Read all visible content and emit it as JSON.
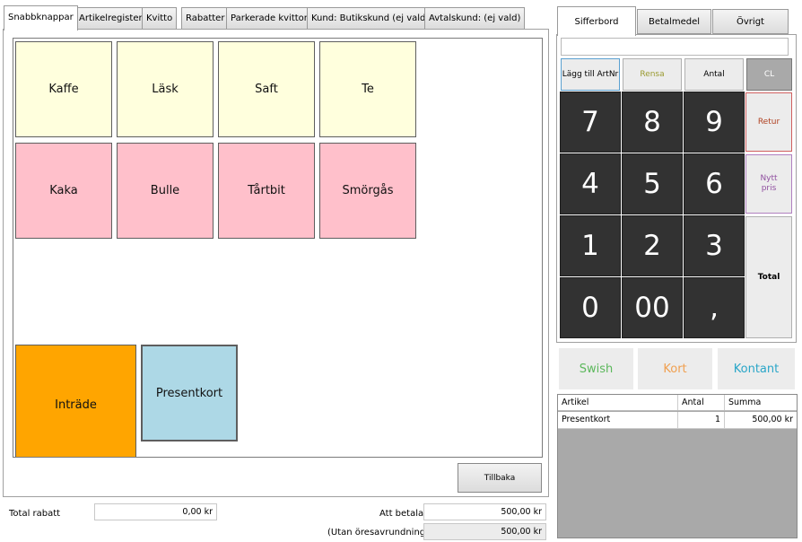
{
  "tabs": [
    "Snabbknappar",
    "Artikelregister",
    "Kvitto",
    "Rabatter",
    "Parkerade kvitton",
    "Kund: Butikskund (ej vald)",
    "Avtalskund: (ej vald)"
  ],
  "quick_buttons": [
    "Kaffe",
    "Läsk",
    "Saft",
    "Te",
    "Kaka",
    "Bulle",
    "Tårtbit",
    "Smörgås",
    "Inträde",
    "Presentkort"
  ],
  "back_label": "Tillbaka",
  "totals": {
    "discount_label": "Total rabatt",
    "discount_value": "0,00 kr",
    "to_pay_label": "Att betala",
    "to_pay_value": "500,00 kr",
    "no_rounding_label": "(Utan öresavrundning)",
    "no_rounding_value": "500,00 kr"
  },
  "right_tabs": [
    "Sifferbord",
    "Betalmedel",
    "Övrigt"
  ],
  "numpad_input": {
    "value": ""
  },
  "fn_buttons": {
    "add_artnr": "Lägg till ArtNr",
    "clear": "Rensa",
    "qty": "Antal",
    "cl": "CL"
  },
  "keys": [
    "7",
    "8",
    "9",
    "4",
    "5",
    "6",
    "1",
    "2",
    "3",
    "0",
    "00",
    ","
  ],
  "side_buttons": {
    "return": "Retur",
    "new_price": "Nytt pris",
    "total": "Total"
  },
  "payment": {
    "swish": "Swish",
    "card": "Kort",
    "cash": "Kontant"
  },
  "receipt": {
    "headers": [
      "Artikel",
      "Antal",
      "Summa"
    ],
    "rows": [
      [
        "Presentkort",
        "1",
        "500,00 kr"
      ]
    ]
  },
  "colors": {
    "drink_button": "#ffffdd",
    "cake_button": "#ffc0cb",
    "entry_button": "#ffa500",
    "gift_button": "#add8e6",
    "key": "#323232",
    "swish": "#5cb85c",
    "card": "#f0a050",
    "cash": "#2aa6c8",
    "clear_text": "#9a9a30",
    "return_text": "#b04020",
    "new_price_text": "#9050a0"
  }
}
